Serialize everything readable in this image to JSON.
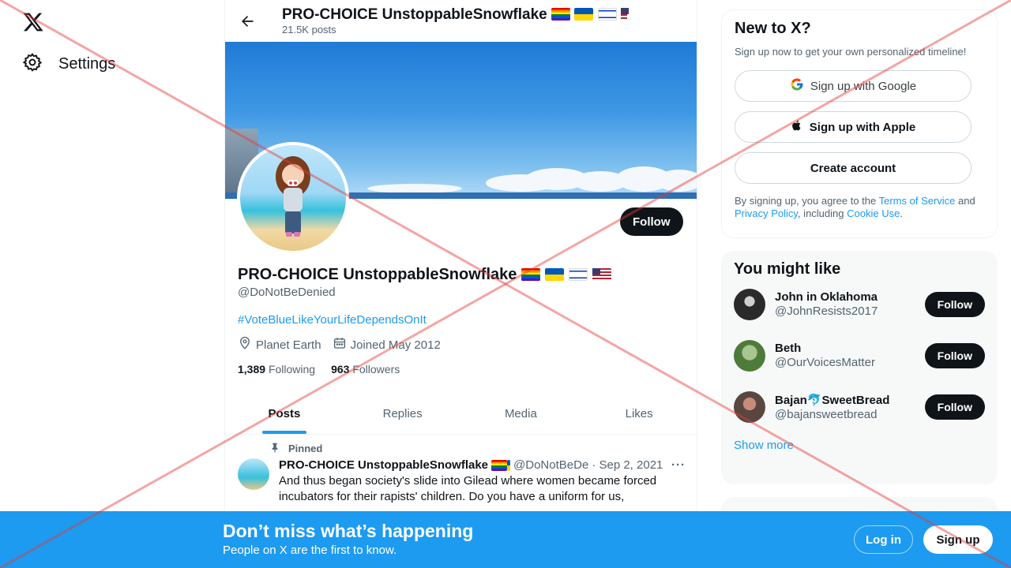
{
  "nav": {
    "settings_label": "Settings"
  },
  "header": {
    "name": "PRO-CHOICE UnstoppableSnowflake",
    "post_count": "21.5K posts"
  },
  "profile": {
    "name": "PRO-CHOICE UnstoppableSnowflake",
    "handle": "@DoNotBeDenied",
    "bio": "#VoteBlueLikeYourLifeDependsOnIt",
    "location": "Planet Earth",
    "joined": "Joined May 2012",
    "following_count": "1,389",
    "following_label": "Following",
    "followers_count": "963",
    "followers_label": "Followers",
    "follow_label": "Follow",
    "flags": [
      "rainbow-flag",
      "ukraine-flag",
      "israel-flag",
      "usa-flag"
    ]
  },
  "tabs": [
    {
      "label": "Posts",
      "active": true
    },
    {
      "label": "Replies",
      "active": false
    },
    {
      "label": "Media",
      "active": false
    },
    {
      "label": "Likes",
      "active": false
    }
  ],
  "tweet": {
    "pinned_label": "Pinned",
    "name": "PRO-CHOICE UnstoppableSnowflake",
    "handle": "@DoNotBeDe",
    "date": "· Sep 2, 2021",
    "more": "···",
    "text": "And thus began society's slide into Gilead where women became forced incubators for their rapists' children. Do you have a uniform for us,"
  },
  "signup_card": {
    "title": "New to X?",
    "subtitle": "Sign up now to get your own personalized timeline!",
    "google_label": "Sign up with Google",
    "apple_label": "Sign up with Apple",
    "create_label": "Create account",
    "legal_prefix": "By signing up, you agree to the ",
    "terms": "Terms of Service",
    "and": " and ",
    "privacy": "Privacy Policy",
    "including": ", including ",
    "cookie": "Cookie Use",
    "period": "."
  },
  "you_might_like": {
    "title": "You might like",
    "follow_label": "Follow",
    "show_more": "Show more",
    "accounts": [
      {
        "name": "John in Oklahoma",
        "handle": "@JohnResists2017"
      },
      {
        "name": "Beth",
        "handle": "@OurVoicesMatter"
      },
      {
        "name": "Bajan🐬SweetBread",
        "handle": "@bajansweetbread"
      }
    ]
  },
  "bottom_bar": {
    "title": "Don’t miss what’s happening",
    "subtitle": "People on X are the first to know.",
    "login_label": "Log in",
    "signup_label": "Sign up"
  },
  "colors": {
    "accent": "#1d9bf0",
    "text": "#0f1419",
    "secondary": "#536471",
    "overlay_x": "#e53935"
  }
}
